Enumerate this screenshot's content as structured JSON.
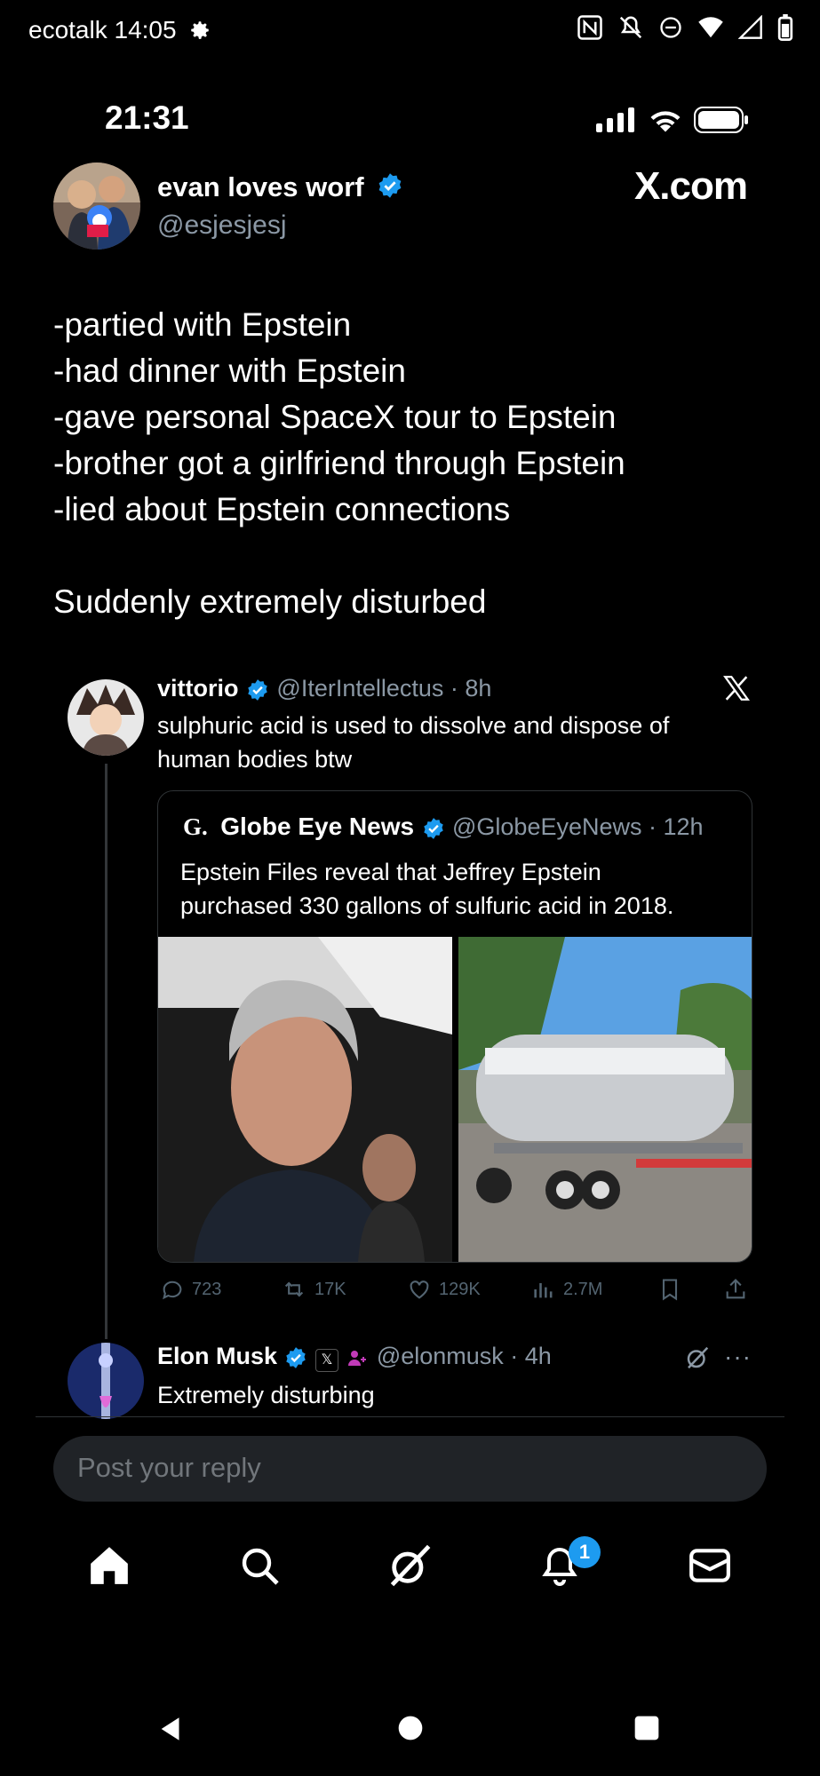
{
  "os_status": {
    "carrier": "ecotalk",
    "time": "14:05"
  },
  "inner_status": {
    "time": "21:31"
  },
  "author": {
    "name": "evan loves worf",
    "handle": "@esjesjesj"
  },
  "brand": "X.com",
  "post_lines": [
    "-partied with Epstein",
    "-had dinner with Epstein",
    "-gave personal SpaceX tour to Epstein",
    "-brother got a girlfriend through Epstein",
    "-lied about Epstein connections",
    "",
    "Suddenly extremely disturbed"
  ],
  "quoted": {
    "name": "vittorio",
    "meta": "@IterIntellectus · 8h",
    "text_lines": [
      "sulphuric acid is used to dissolve and dispose of",
      "human bodies btw"
    ],
    "nested": {
      "name": "Globe Eye News",
      "meta": "@GlobeEyeNews · 12h",
      "text_lines": [
        "Epstein Files reveal that Jeffrey Epstein",
        "purchased 330 gallons of sulfuric acid in 2018."
      ]
    },
    "stats": {
      "replies": "723",
      "reposts": "17K",
      "likes": "129K",
      "views": "2.7M"
    }
  },
  "reply": {
    "name": "Elon Musk",
    "meta": "@elonmusk · 4h",
    "text": "Extremely disturbing"
  },
  "reply_placeholder": "Post your reply",
  "notifications_badge": "1",
  "colors": {
    "accent": "#1d9bf0",
    "background": "#000000",
    "muted": "#8b98a5"
  }
}
